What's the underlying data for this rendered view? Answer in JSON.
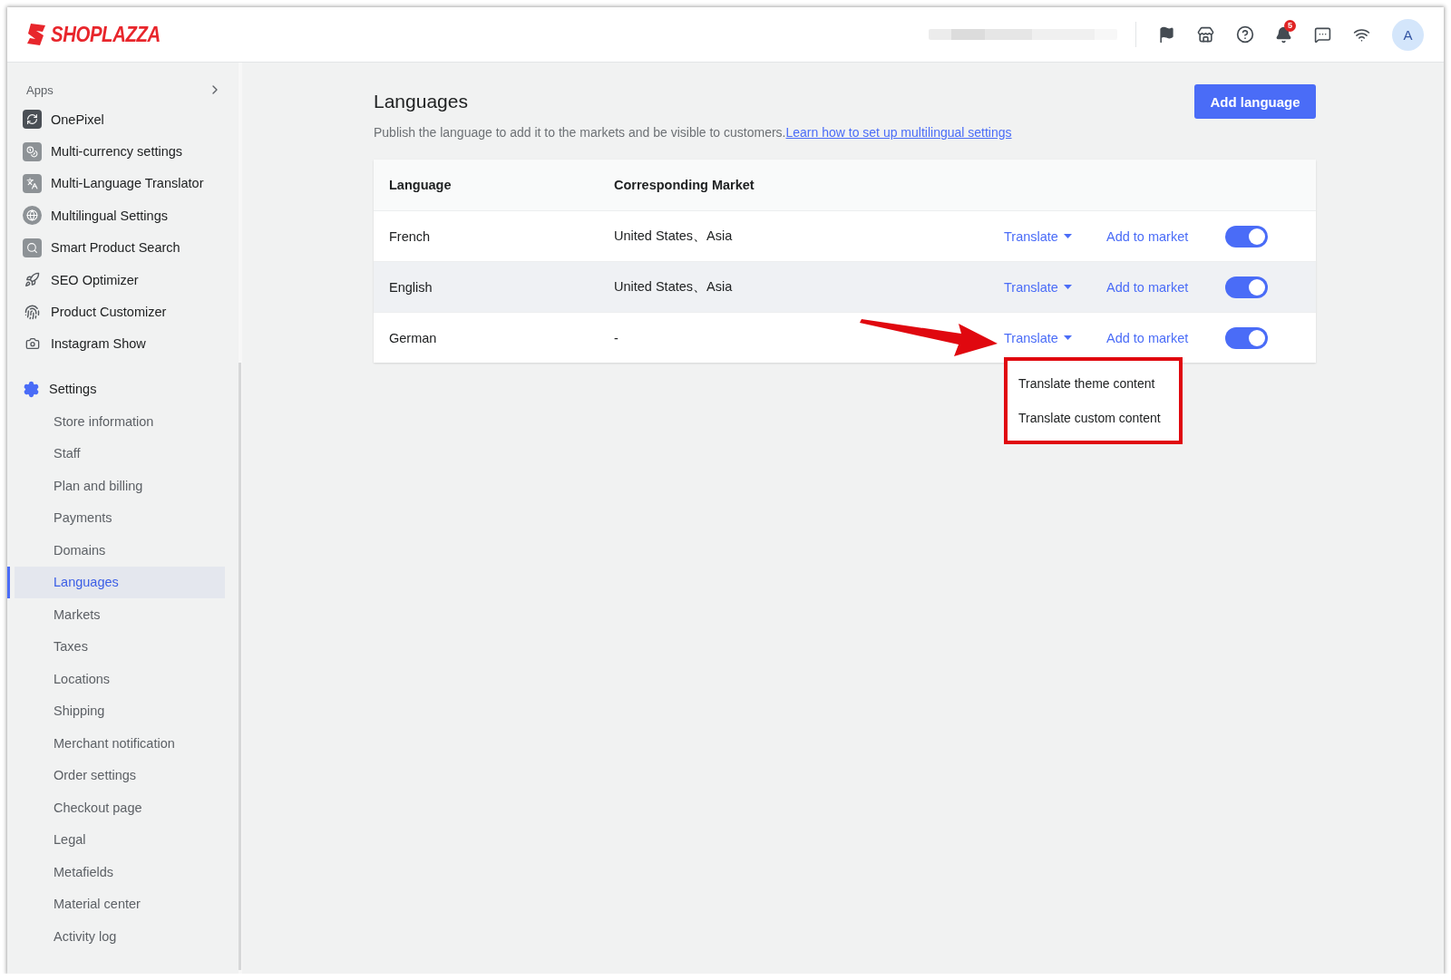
{
  "header": {
    "logo": "SHOPLAZZA",
    "notification_count": "5",
    "avatar_initial": "A"
  },
  "sidebar": {
    "apps_label": "Apps",
    "apps": [
      {
        "label": "OnePixel"
      },
      {
        "label": "Multi-currency settings"
      },
      {
        "label": "Multi-Language Translator"
      },
      {
        "label": "Multilingual Settings"
      },
      {
        "label": "Smart Product Search"
      },
      {
        "label": "SEO Optimizer"
      },
      {
        "label": "Product Customizer"
      },
      {
        "label": "Instagram Show"
      }
    ],
    "settings_label": "Settings",
    "settings": [
      {
        "label": "Store information",
        "selected": false
      },
      {
        "label": "Staff",
        "selected": false
      },
      {
        "label": "Plan and billing",
        "selected": false
      },
      {
        "label": "Payments",
        "selected": false
      },
      {
        "label": "Domains",
        "selected": false
      },
      {
        "label": "Languages",
        "selected": true
      },
      {
        "label": "Markets",
        "selected": false
      },
      {
        "label": "Taxes",
        "selected": false
      },
      {
        "label": "Locations",
        "selected": false
      },
      {
        "label": "Shipping",
        "selected": false
      },
      {
        "label": "Merchant notification",
        "selected": false
      },
      {
        "label": "Order settings",
        "selected": false
      },
      {
        "label": "Checkout page",
        "selected": false
      },
      {
        "label": "Legal",
        "selected": false
      },
      {
        "label": "Metafields",
        "selected": false
      },
      {
        "label": "Material center",
        "selected": false
      },
      {
        "label": "Activity log",
        "selected": false
      }
    ]
  },
  "page": {
    "title": "Languages",
    "add_button": "Add language",
    "description": "Publish the language to add it to the markets and be visible to customers.",
    "help_link": "Learn how to set up multilingual settings"
  },
  "table": {
    "columns": [
      "Language",
      "Corresponding Market"
    ],
    "rows": [
      {
        "language": "French",
        "market": "United States、Asia",
        "translate": "Translate",
        "add_to_market": "Add to market",
        "on": true,
        "hovered": false,
        "menu_open": false
      },
      {
        "language": "English",
        "market": "United States、Asia",
        "translate": "Translate",
        "add_to_market": "Add to market",
        "on": true,
        "hovered": true,
        "menu_open": false
      },
      {
        "language": "German",
        "market": "-",
        "translate": "Translate",
        "add_to_market": "Add to market",
        "on": true,
        "hovered": false,
        "menu_open": true
      }
    ]
  },
  "translate_menu": {
    "items": [
      "Translate theme content",
      "Translate custom content"
    ]
  }
}
